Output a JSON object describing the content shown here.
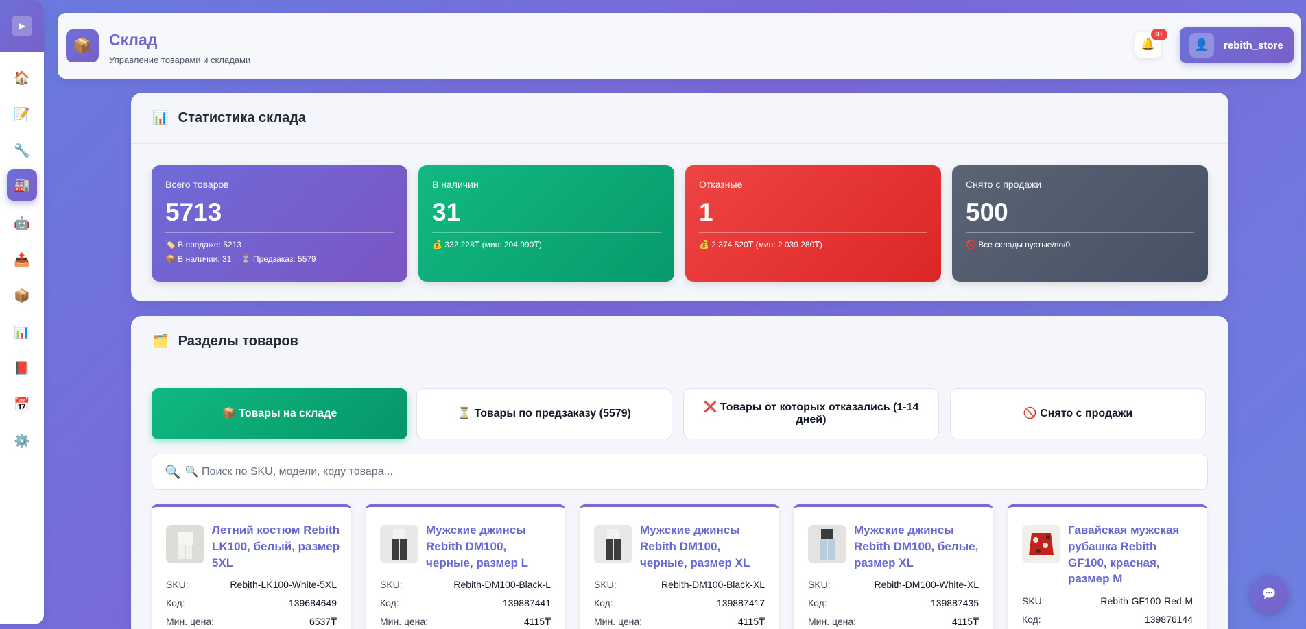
{
  "sidebar": {
    "toggle_icon": "play-icon",
    "items": [
      {
        "name": "home",
        "icon": "🏠"
      },
      {
        "name": "documents",
        "icon": "📝"
      },
      {
        "name": "tools",
        "icon": "🔧"
      },
      {
        "name": "warehouse",
        "icon": "🏭",
        "active": true
      },
      {
        "name": "robot",
        "icon": "🤖"
      },
      {
        "name": "upload",
        "icon": "📤"
      },
      {
        "name": "boxes",
        "icon": "📦"
      },
      {
        "name": "stats",
        "icon": "📊"
      },
      {
        "name": "book",
        "icon": "📕"
      },
      {
        "name": "calendar",
        "icon": "📅"
      },
      {
        "name": "settings",
        "icon": "⚙️"
      }
    ]
  },
  "header": {
    "logo_icon": "📦",
    "title": "Склад",
    "subtitle": "Управление товарами и складами",
    "bell_icon": "🔔",
    "notifications_badge": "9+",
    "user_icon": "👤",
    "username": "rebith_store"
  },
  "stats": {
    "icon": "📊",
    "title": "Статистика склада",
    "cards": [
      {
        "label": "Всего товаров",
        "value": "5713",
        "note1": "🏷️ В продаже: 5213",
        "note2": "📦 В наличии: 31    ⏳ Предзаказ: 5579",
        "color": "#7c5fd0"
      },
      {
        "label": "В наличии",
        "value": "31",
        "note1": "💰 332 228₸ (мин: 204 990₸)",
        "note2": "",
        "color": "#10b981"
      },
      {
        "label": "Отказные",
        "value": "1",
        "note1": "💰 2 374 520₸ (мин: 2 039 280₸)",
        "note2": "",
        "color": "#ef4444"
      },
      {
        "label": "Снято с продажи",
        "value": "500",
        "note1": "🚫 Все склады пустые/no/0",
        "note2": "",
        "color": "#4b5563"
      }
    ]
  },
  "sections": {
    "icon": "🗂️",
    "title": "Разделы товаров",
    "tabs": [
      {
        "label": "📦 Товары на складе",
        "active": true
      },
      {
        "label": "⏳ Товары по предзаказу (5579)",
        "active": false
      },
      {
        "label": "❌ Товары от которых отказались (1-14 дней)",
        "active": false
      },
      {
        "label": "🚫 Снято с продажи",
        "active": false
      }
    ],
    "search": {
      "icon": "🔍",
      "placeholder": "🔍 Поиск по SKU, модели, коду товара..."
    }
  },
  "product_labels": {
    "sku": "SKU:",
    "code": "Код:",
    "min_price": "Мин. цена:"
  },
  "products": [
    {
      "name": "Летний костюм Rebith LK100, белый, размер 5XL",
      "sku": "Rebith-LK100-White-5XL",
      "code": "139684649",
      "min_price": "6537₸",
      "thumb": "white-suit"
    },
    {
      "name": "Мужские джинсы Rebith DM100, черные, размер L",
      "sku": "Rebith-DM100-Black-L",
      "code": "139887441",
      "min_price": "4115₸",
      "thumb": "black-jeans"
    },
    {
      "name": "Мужские джинсы Rebith DM100, черные, размер XL",
      "sku": "Rebith-DM100-Black-XL",
      "code": "139887417",
      "min_price": "4115₸",
      "thumb": "black-jeans"
    },
    {
      "name": "Мужские джинсы Rebith DM100, белые, размер XL",
      "sku": "Rebith-DM100-White-XL",
      "code": "139887435",
      "min_price": "4115₸",
      "thumb": "white-jeans"
    },
    {
      "name": "Гавайская мужская рубашка Rebith GF100, красная, размер M",
      "sku": "Rebith-GF100-Red-M",
      "code": "139876144",
      "min_price": "",
      "thumb": "red-shirt"
    }
  ],
  "chat": {
    "icon": "chat-bubble-icon"
  }
}
